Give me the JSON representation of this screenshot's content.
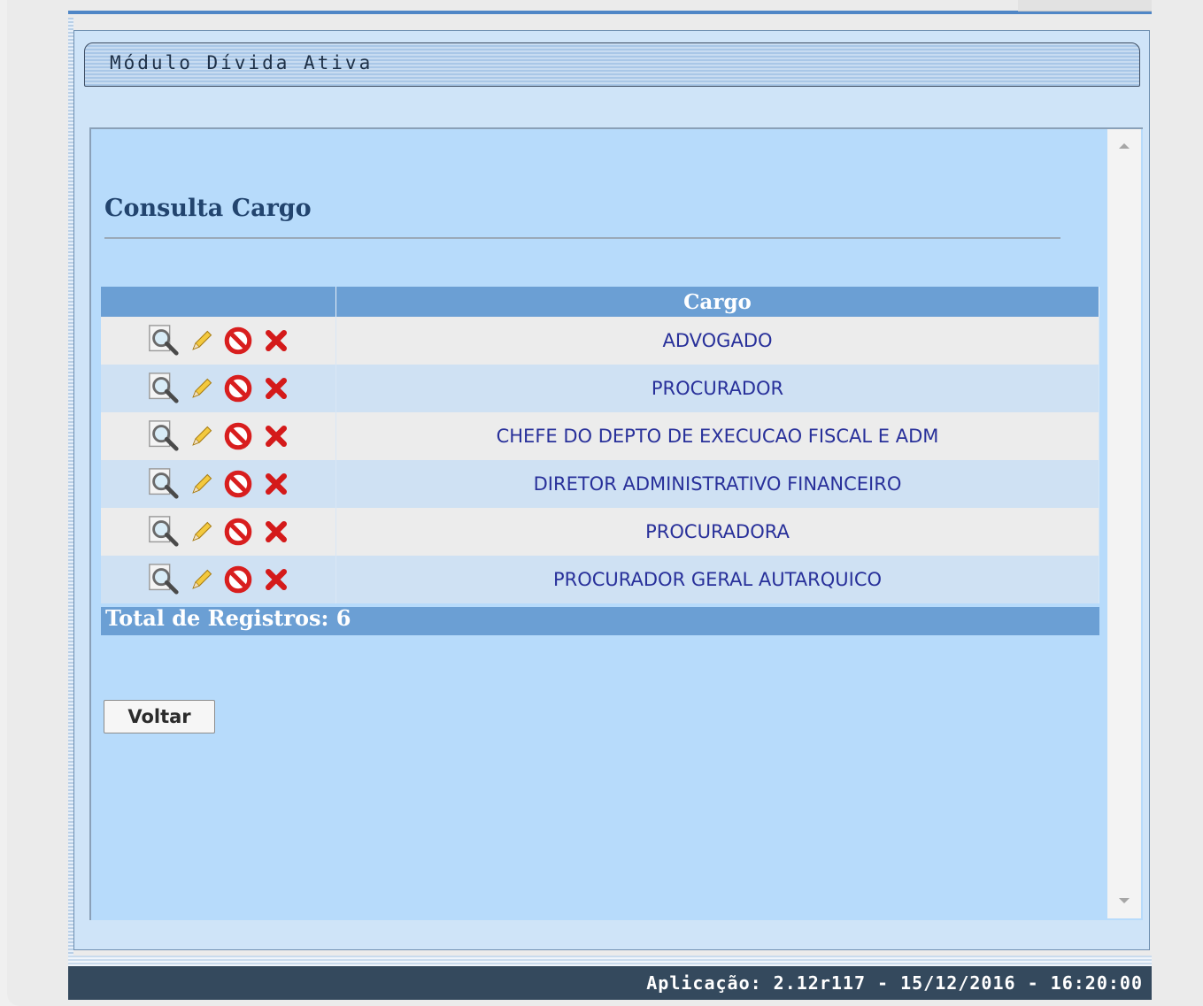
{
  "module": {
    "title": "Módulo Dívida Ativa"
  },
  "page": {
    "title": "Consulta Cargo"
  },
  "table": {
    "headers": [
      "",
      "Cargo"
    ],
    "rows": [
      {
        "cargo": "ADVOGADO"
      },
      {
        "cargo": "PROCURADOR"
      },
      {
        "cargo": "CHEFE DO DEPTO DE EXECUCAO FISCAL E ADM"
      },
      {
        "cargo": "DIRETOR ADMINISTRATIVO FINANCEIRO"
      },
      {
        "cargo": "PROCURADORA"
      },
      {
        "cargo": "PROCURADOR GERAL AUTARQUICO"
      }
    ],
    "row_actions": [
      "view-icon",
      "edit-icon",
      "disable-icon",
      "delete-icon"
    ],
    "total_label": "Total de Registros: 6"
  },
  "buttons": {
    "back": "Voltar"
  },
  "footer": {
    "text": "Aplicação: 2.12r117 - 15/12/2016 - 16:20:00"
  },
  "colors": {
    "header_bg": "#6b9fd4",
    "content_bg": "#b7dbfb",
    "footer_bg": "#34495d",
    "link_text": "#28309a"
  }
}
